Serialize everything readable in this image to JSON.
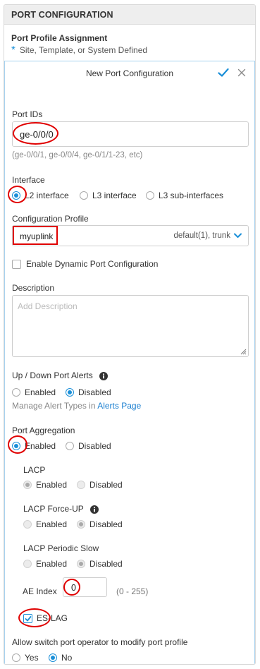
{
  "header": {
    "title": "PORT CONFIGURATION"
  },
  "profile_assignment": {
    "title": "Port Profile Assignment",
    "star": "*",
    "subtitle": "Site, Template, or System Defined"
  },
  "card": {
    "title": "New Port Configuration",
    "save_icon": "checkmark-icon",
    "close_icon": "close-icon"
  },
  "port_ids": {
    "label": "Port IDs",
    "value": "ge-0/0/0",
    "hint": "(ge-0/0/1, ge-0/0/4, ge-0/1/1-23, etc)"
  },
  "interface": {
    "label": "Interface",
    "options": [
      "L2 interface",
      "L3 interface",
      "L3 sub-interfaces"
    ],
    "selected": "L2 interface"
  },
  "config_profile": {
    "label": "Configuration Profile",
    "value": "myuplink",
    "meta": "default(1), trunk"
  },
  "dynamic_port": {
    "label": "Enable Dynamic Port Configuration",
    "checked": false
  },
  "description": {
    "label": "Description",
    "placeholder": "Add Description"
  },
  "alerts": {
    "label": "Up / Down Port Alerts",
    "options": [
      "Enabled",
      "Disabled"
    ],
    "selected": "Disabled",
    "manage_prefix": "Manage Alert Types in",
    "manage_link": "Alerts Page"
  },
  "aggregation": {
    "label": "Port Aggregation",
    "options": [
      "Enabled",
      "Disabled"
    ],
    "selected": "Enabled"
  },
  "lacp": {
    "label": "LACP",
    "options": [
      "Enabled",
      "Disabled"
    ],
    "selected": "Enabled"
  },
  "lacp_force_up": {
    "label": "LACP Force-UP",
    "options": [
      "Enabled",
      "Disabled"
    ],
    "selected": "Disabled"
  },
  "lacp_periodic_slow": {
    "label": "LACP Periodic Slow",
    "options": [
      "Enabled",
      "Disabled"
    ],
    "selected": "Disabled"
  },
  "ae_index": {
    "label": "AE Index",
    "value": "0",
    "range": "(0 - 255)"
  },
  "es_lag": {
    "label": "ES-LAG",
    "checked": true
  },
  "operator_modify": {
    "label": "Allow switch port operator to modify port profile",
    "options": [
      "Yes",
      "No"
    ],
    "selected": "No"
  },
  "colors": {
    "accent": "#1a8fd8",
    "annotation": "#e00000",
    "header_bg": "#eeeeee"
  }
}
